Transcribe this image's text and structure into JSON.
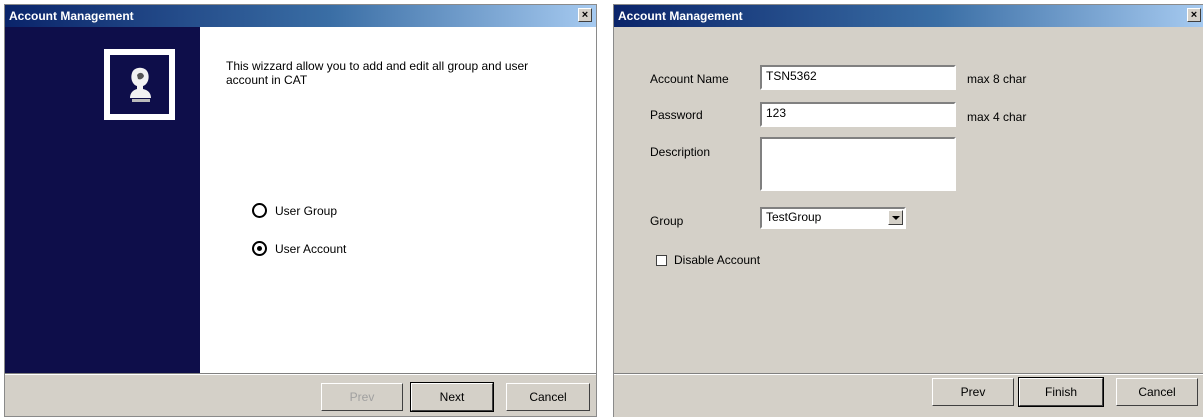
{
  "left_window": {
    "title": "Account Management",
    "close_glyph": "×",
    "intro_text": "This wizzard allow you to add and edit all group and user account in CAT",
    "options": [
      {
        "label": "User Group",
        "selected": false
      },
      {
        "label": "User Account",
        "selected": true
      }
    ],
    "buttons": {
      "prev": "Prev",
      "next": "Next",
      "cancel": "Cancel"
    },
    "logo_icon": "user-silhouette-icon",
    "nav_panel_color": "#0e0e4a"
  },
  "right_window": {
    "title": "Account Management",
    "close_glyph": "×",
    "form": {
      "account_name_label": "Account Name",
      "account_name_value": "TSN5362",
      "account_name_hint": "max 8 char",
      "password_label": "Password",
      "password_value": "123",
      "password_hint": "max 4 char",
      "description_label": "Description",
      "description_value": "",
      "group_label": "Group",
      "group_value": "TestGroup",
      "disable_account_label": "Disable Account",
      "disable_account_checked": false
    },
    "buttons": {
      "prev": "Prev",
      "finish": "Finish",
      "cancel": "Cancel"
    }
  },
  "colors": {
    "titlebar_start": "#0a246a",
    "titlebar_end": "#a6caf0",
    "dialog_face": "#d4d0c8"
  }
}
